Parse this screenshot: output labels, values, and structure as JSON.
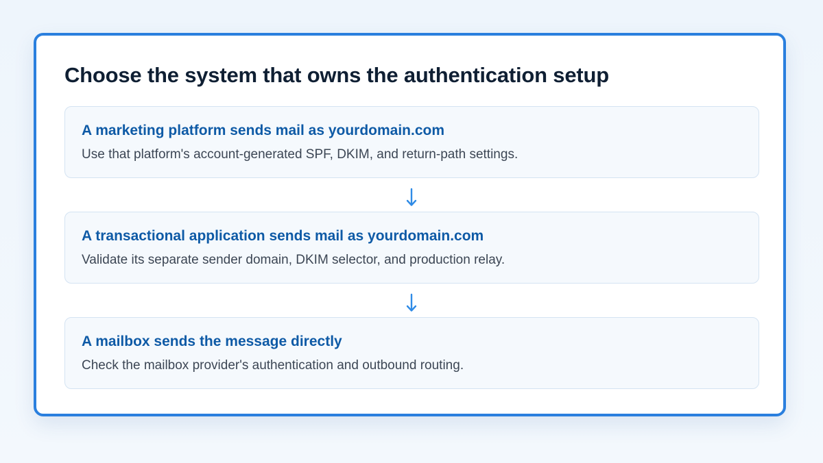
{
  "title": "Choose the system that owns the authentication setup",
  "steps": [
    {
      "title": "A marketing platform sends mail as yourdomain.com",
      "description": "Use that platform's account-generated SPF, DKIM, and return-path settings."
    },
    {
      "title": "A transactional application sends mail as yourdomain.com",
      "description": "Validate its separate sender domain, DKIM selector, and production relay."
    },
    {
      "title": "A mailbox sends the message directly",
      "description": "Check the mailbox provider's authentication and outbound routing."
    }
  ],
  "colors": {
    "accent": "#2a7fde",
    "step_title": "#0e5aa6",
    "arrow": "#2f8be6"
  }
}
